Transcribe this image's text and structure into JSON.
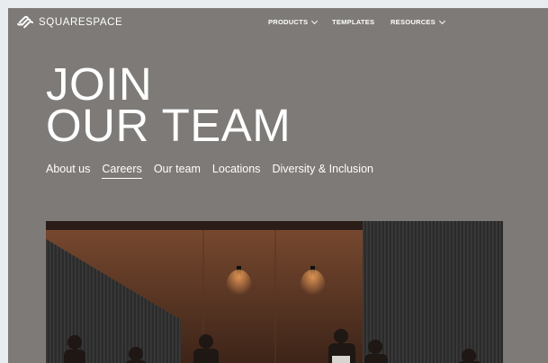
{
  "brand": {
    "name": "SQUARESPACE"
  },
  "nav": {
    "products_label": "PRODUCTS",
    "templates_label": "TEMPLATES",
    "resources_label": "RESOURCES"
  },
  "hero": {
    "line1": "JOIN",
    "line2": "OUR TEAM"
  },
  "subnav": {
    "items": [
      {
        "label": "About us"
      },
      {
        "label": "Careers"
      },
      {
        "label": "Our team"
      },
      {
        "label": "Locations"
      },
      {
        "label": "Diversity & Inclusion"
      }
    ],
    "active": "Careers"
  },
  "colors": {
    "background": "#7d7a77",
    "text": "#ffffff"
  }
}
